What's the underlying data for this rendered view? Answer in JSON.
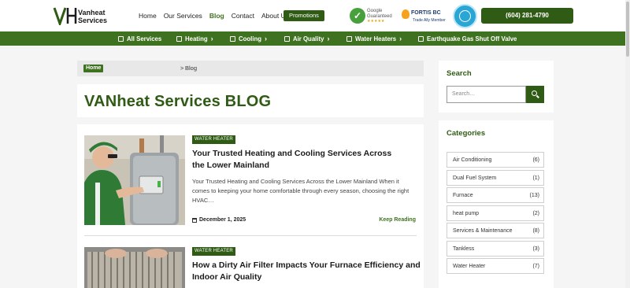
{
  "header": {
    "brand_line1": "Vanheat",
    "brand_line2": "Services",
    "nav": [
      "Home",
      "Our Services",
      "Blog",
      "Contact",
      "About Us"
    ],
    "promo_label": "Promotions",
    "google_badge": {
      "line1": "Google",
      "line2": "Guaranteed",
      "stars": "★★★★★"
    },
    "fortis_badge": {
      "name": "FORTIS BC",
      "sub": "Trade Ally Member"
    },
    "phone": "(604) 281-4790"
  },
  "mainnav": [
    {
      "label": "All Services",
      "icon": "grid-icon",
      "chevron": false
    },
    {
      "label": "Heating",
      "icon": "heater-icon",
      "chevron": true
    },
    {
      "label": "Cooling",
      "icon": "ac-unit-icon",
      "chevron": true
    },
    {
      "label": "Air Quality",
      "icon": "air-filter-icon",
      "chevron": true
    },
    {
      "label": "Water Heaters",
      "icon": "water-heater-icon",
      "chevron": true
    },
    {
      "label": "Earthquake Gas Shut Off Valve",
      "icon": "valve-icon",
      "chevron": false
    }
  ],
  "breadcrumb": {
    "home": "Home",
    "separator": ">",
    "current": "Blog"
  },
  "page_title": "VANheat Services BLOG",
  "posts": [
    {
      "tag": "WATER HEATER",
      "title": "Your Trusted Heating and Cooling Services Across the Lower Mainland",
      "excerpt": "Your Trusted Heating and Cooling Services Across the Lower Mainland When it comes to keeping your home comfortable through every season, choosing the right HVAC…",
      "date": "December 1, 2025",
      "read_more": "Keep Reading"
    },
    {
      "tag": "WATER HEATER",
      "title": "How a Dirty Air Filter Impacts Your Furnace Efficiency and Indoor Air Quality",
      "excerpt": "",
      "date": "",
      "read_more": ""
    }
  ],
  "sidebar": {
    "search_title": "Search",
    "search_placeholder": "Search…",
    "categories_title": "Categories",
    "categories": [
      {
        "name": "Air Conditioning",
        "count": "(6)"
      },
      {
        "name": "Dual Fuel System",
        "count": "(1)"
      },
      {
        "name": "Furnace",
        "count": "(13)"
      },
      {
        "name": "heat pump",
        "count": "(2)"
      },
      {
        "name": "Services & Maintenance",
        "count": "(8)"
      },
      {
        "name": "Tankless",
        "count": "(3)"
      },
      {
        "name": "Water Heater",
        "count": "(7)"
      }
    ]
  },
  "colors": {
    "brand_green": "#2f5b14",
    "nav_green": "#3f7220",
    "accent_orange": "#f6a21c"
  }
}
